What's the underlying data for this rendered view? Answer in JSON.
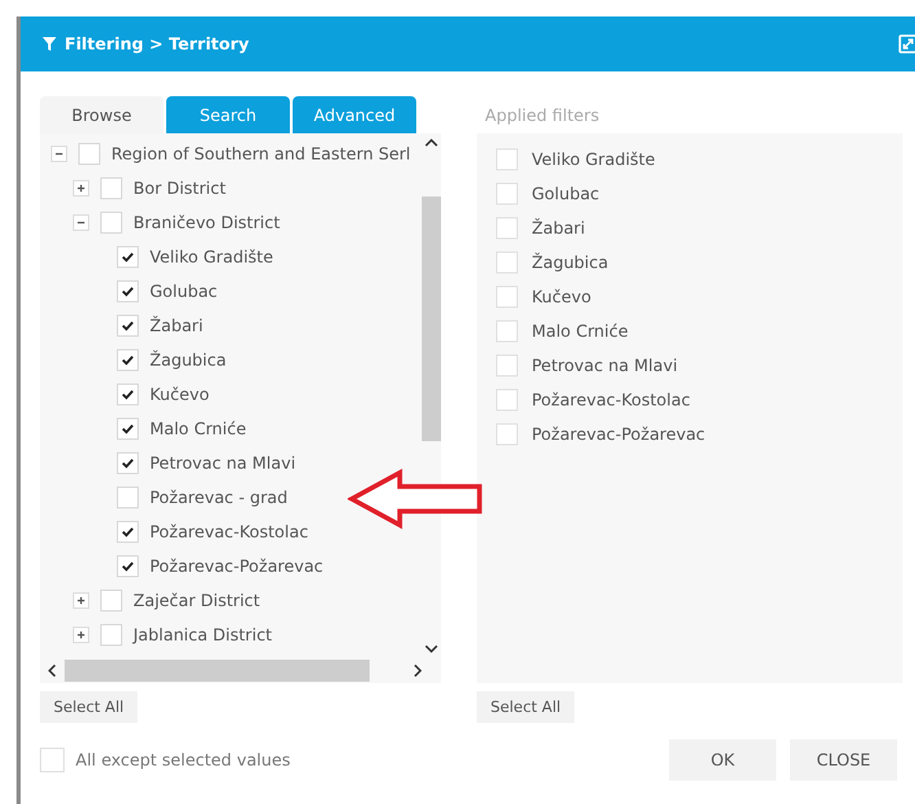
{
  "window": {
    "title": "Filtering > Territory"
  },
  "tabs": [
    {
      "label": "Browse",
      "selected": true
    },
    {
      "label": "Search",
      "selected": false
    },
    {
      "label": "Advanced",
      "selected": false
    }
  ],
  "tree": [
    {
      "label": "Region of Southern and Eastern Serl",
      "checked": false,
      "expanded": true,
      "children": [
        {
          "label": "Bor District",
          "checked": false,
          "expanded": false
        },
        {
          "label": "Braničevo District",
          "checked": false,
          "expanded": true,
          "children": [
            {
              "label": "Veliko Gradište",
              "checked": true
            },
            {
              "label": "Golubac",
              "checked": true
            },
            {
              "label": "Žabari",
              "checked": true
            },
            {
              "label": "Žagubica",
              "checked": true
            },
            {
              "label": "Kučevo",
              "checked": true
            },
            {
              "label": "Malo Crniće",
              "checked": true
            },
            {
              "label": "Petrovac na Mlavi",
              "checked": true
            },
            {
              "label": "Požarevac - grad",
              "checked": false
            },
            {
              "label": "Požarevac-Kostolac",
              "checked": true
            },
            {
              "label": "Požarevac-Požarevac",
              "checked": true
            }
          ]
        },
        {
          "label": "Zaječar District",
          "checked": false,
          "expanded": false
        },
        {
          "label": "Jablanica District",
          "checked": false,
          "expanded": false
        }
      ]
    }
  ],
  "applied_filters": {
    "title": "Applied filters",
    "items": [
      {
        "label": "Veliko Gradište",
        "checked": false
      },
      {
        "label": "Golubac",
        "checked": false
      },
      {
        "label": "Žabari",
        "checked": false
      },
      {
        "label": "Žagubica",
        "checked": false
      },
      {
        "label": "Kučevo",
        "checked": false
      },
      {
        "label": "Malo Crniće",
        "checked": false
      },
      {
        "label": "Petrovac na Mlavi",
        "checked": false
      },
      {
        "label": "Požarevac-Kostolac",
        "checked": false
      },
      {
        "label": "Požarevac-Požarevac",
        "checked": false
      }
    ]
  },
  "select_all_buttons": [
    "Select All",
    "Select All"
  ],
  "all_except": {
    "label": "All except selected values",
    "checked": false
  },
  "buttons": [
    "OK",
    "CLOSE"
  ]
}
